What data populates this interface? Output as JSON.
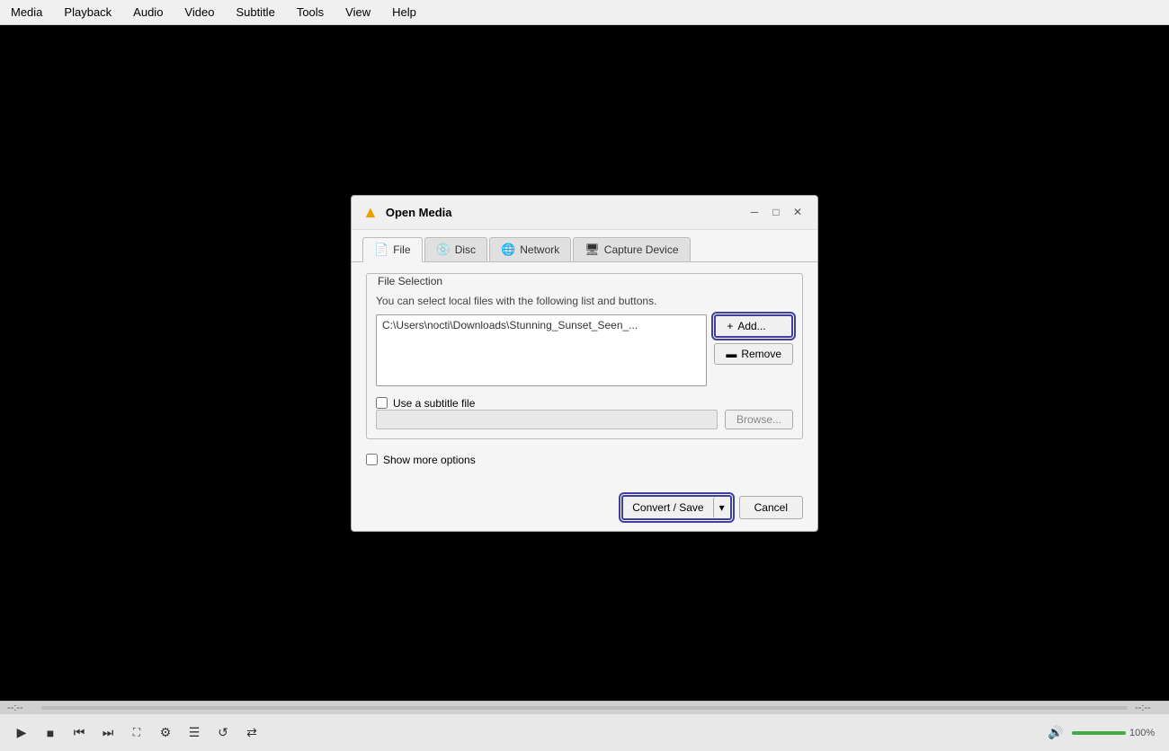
{
  "menu": {
    "items": [
      "Media",
      "Playback",
      "Audio",
      "Video",
      "Subtitle",
      "Tools",
      "View",
      "Help"
    ]
  },
  "dialog": {
    "title": "Open Media",
    "title_icon": "▲",
    "tabs": [
      {
        "id": "file",
        "label": "File",
        "icon": "📄",
        "active": true
      },
      {
        "id": "disc",
        "label": "Disc",
        "icon": "💿"
      },
      {
        "id": "network",
        "label": "Network",
        "icon": "🌐"
      },
      {
        "id": "capture",
        "label": "Capture Device",
        "icon": "🖥"
      }
    ],
    "file_selection": {
      "group_title": "File Selection",
      "description": "You can select local files with the following list and buttons.",
      "file_path": "C:\\Users\\nocti\\Downloads\\Stunning_Sunset_Seen_...",
      "add_button": "Add...",
      "remove_button": "Remove"
    },
    "subtitle": {
      "checkbox_label": "Use a subtitle file",
      "browse_label": "Browse..."
    },
    "show_more": {
      "checkbox_label": "Show more options"
    },
    "footer": {
      "convert_save": "Convert / Save",
      "cancel": "Cancel"
    }
  },
  "bottom_bar": {
    "time_left": "--:--",
    "time_right": "--:--",
    "volume_pct": "100%"
  },
  "wm_buttons": {
    "minimize": "─",
    "maximize": "□",
    "close": "✕"
  }
}
